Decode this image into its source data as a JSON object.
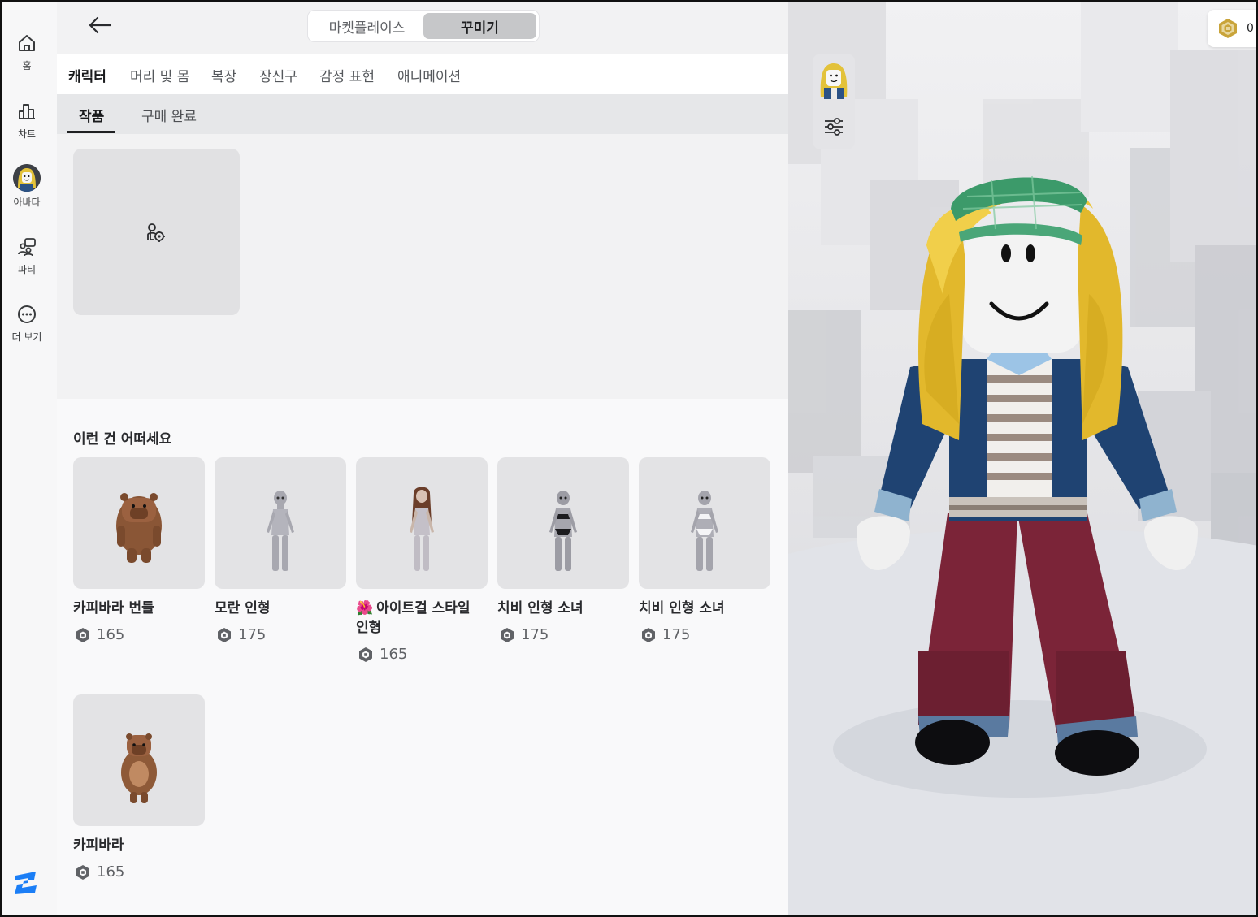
{
  "nav": {
    "items": [
      {
        "label": "홈",
        "icon": "home-icon"
      },
      {
        "label": "차트",
        "icon": "chart-icon"
      },
      {
        "label": "아바타",
        "icon": "avatar-icon"
      },
      {
        "label": "파티",
        "icon": "party-icon"
      },
      {
        "label": "더 보기",
        "icon": "more-icon"
      }
    ],
    "logo": "roblox-studio-logo"
  },
  "topbar": {
    "segments": [
      {
        "label": "마켓플레이스",
        "active": false
      },
      {
        "label": "꾸미기",
        "active": true
      }
    ]
  },
  "category_tabs": [
    {
      "label": "캐릭터",
      "active": true
    },
    {
      "label": "머리 및 몸",
      "active": false
    },
    {
      "label": "복장",
      "active": false
    },
    {
      "label": "장신구",
      "active": false
    },
    {
      "label": "감정 표현",
      "active": false
    },
    {
      "label": "애니메이션",
      "active": false
    }
  ],
  "sub_tabs": [
    {
      "label": "작품",
      "active": true
    },
    {
      "label": "구매 완료",
      "active": false
    }
  ],
  "recommendations": {
    "title": "이런 건 어떠세요",
    "items": [
      {
        "name": "카피바라 번들",
        "price": "165",
        "thumb": "capybara-bundle"
      },
      {
        "name": "모란 인형",
        "price": "175",
        "thumb": "doll-gray"
      },
      {
        "name_prefix": "🌺",
        "name": "아이트걸 스타일 인형",
        "price": "165",
        "thumb": "doll-brunette"
      },
      {
        "name": "치비 인형 소녀",
        "price": "175",
        "thumb": "doll-black-swimsuit"
      },
      {
        "name": "치비 인형 소녀",
        "price": "175",
        "thumb": "doll-white-swimsuit"
      },
      {
        "name": "카피바라",
        "price": "165",
        "thumb": "capybara"
      }
    ]
  },
  "preview": {
    "balance": "0",
    "currency_icon": "robux-icon"
  }
}
